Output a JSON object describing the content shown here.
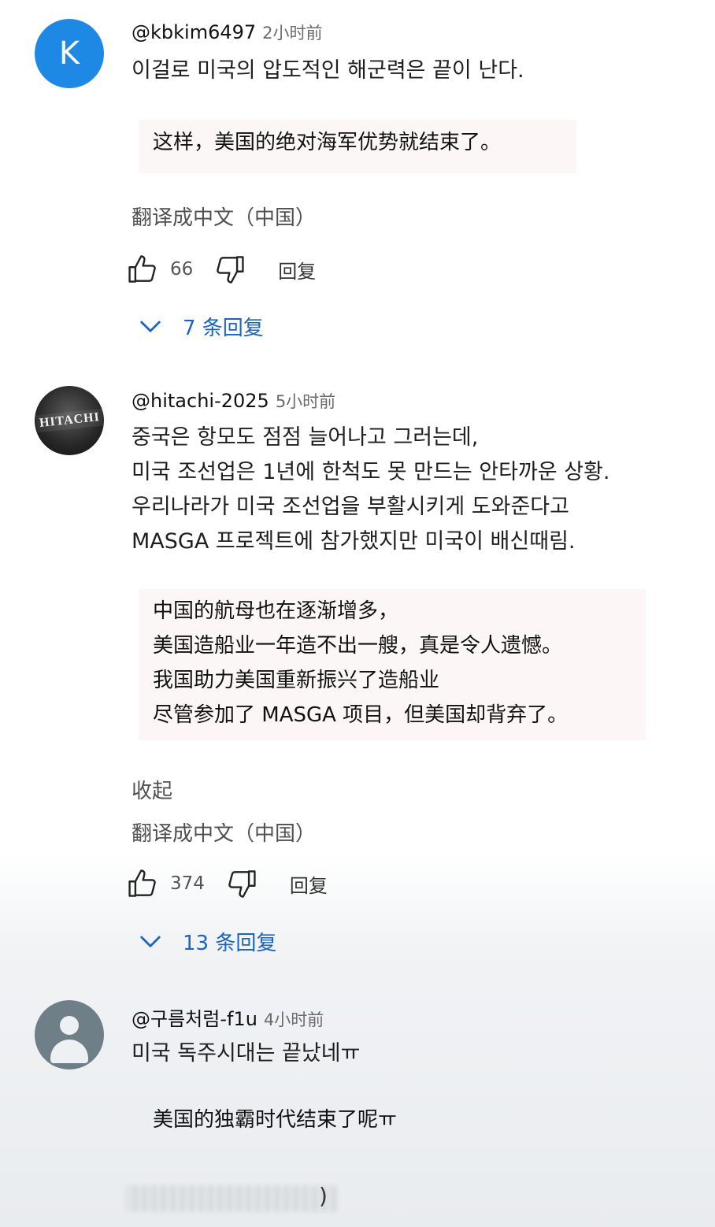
{
  "comments": [
    {
      "avatar_letter": "K",
      "handle": "@kbkim6497",
      "time": "2小时前",
      "original": [
        "이걸로 미국의 압도적인 해군력은 끝이 난다."
      ],
      "translation": [
        "这样，美国的绝对海军优势就结束了。"
      ],
      "translate_link": "翻译成中文（中国）",
      "likes": "66",
      "reply_label": "回复",
      "replies_label": "7 条回复"
    },
    {
      "avatar_text": "HITACHI",
      "handle": "@hitachi-2025",
      "time": "5小时前",
      "original": [
        "중국은 항모도 점점 늘어나고 그러는데,",
        "미국 조선업은 1년에 한척도 못 만드는 안타까운 상황.",
        "우리나라가 미국 조선업을 부활시키게 도와준다고",
        "MASGA 프로젝트에 참가했지만 미국이 배신때림."
      ],
      "translation": [
        "中国的航母也在逐渐增多，",
        "美国造船业一年造不出一艘，真是令人遗憾。",
        "我国助力美国重新振兴了造船业",
        "尽管参加了 MASGA 项目，但美国却背弃了。"
      ],
      "collapse_link": "收起",
      "translate_link": "翻译成中文（中国）",
      "likes": "374",
      "reply_label": "回复",
      "replies_label": "13 条回复"
    },
    {
      "handle": "@구름처럼-f1u",
      "time": "4小时前",
      "original": [
        "미국 독주시대는 끝났네ㅠ"
      ],
      "translation": [
        "美国的独霸时代结束了呢ㅠ"
      ],
      "partial_text": ")"
    }
  ],
  "colors": {
    "reply_link": "#1a64c8",
    "avatar_k": "#1e88e5",
    "translation_bg": "#fcf7f6"
  },
  "icons": [
    "thumbs-up-icon",
    "thumbs-down-icon",
    "chevron-down-icon"
  ]
}
